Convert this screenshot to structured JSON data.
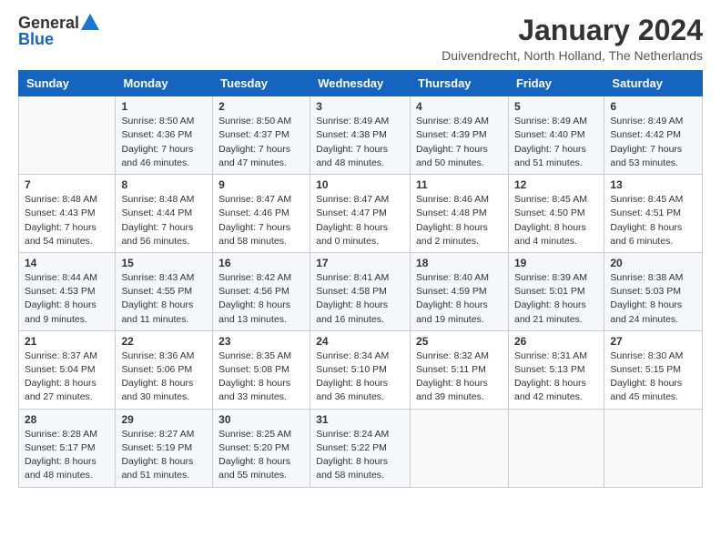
{
  "header": {
    "logo_general": "General",
    "logo_blue": "Blue",
    "month_title": "January 2024",
    "location": "Duivendrecht, North Holland, The Netherlands"
  },
  "days_of_week": [
    "Sunday",
    "Monday",
    "Tuesday",
    "Wednesday",
    "Thursday",
    "Friday",
    "Saturday"
  ],
  "weeks": [
    [
      {
        "day": "",
        "sunrise": "",
        "sunset": "",
        "daylight": ""
      },
      {
        "day": "1",
        "sunrise": "Sunrise: 8:50 AM",
        "sunset": "Sunset: 4:36 PM",
        "daylight": "Daylight: 7 hours and 46 minutes."
      },
      {
        "day": "2",
        "sunrise": "Sunrise: 8:50 AM",
        "sunset": "Sunset: 4:37 PM",
        "daylight": "Daylight: 7 hours and 47 minutes."
      },
      {
        "day": "3",
        "sunrise": "Sunrise: 8:49 AM",
        "sunset": "Sunset: 4:38 PM",
        "daylight": "Daylight: 7 hours and 48 minutes."
      },
      {
        "day": "4",
        "sunrise": "Sunrise: 8:49 AM",
        "sunset": "Sunset: 4:39 PM",
        "daylight": "Daylight: 7 hours and 50 minutes."
      },
      {
        "day": "5",
        "sunrise": "Sunrise: 8:49 AM",
        "sunset": "Sunset: 4:40 PM",
        "daylight": "Daylight: 7 hours and 51 minutes."
      },
      {
        "day": "6",
        "sunrise": "Sunrise: 8:49 AM",
        "sunset": "Sunset: 4:42 PM",
        "daylight": "Daylight: 7 hours and 53 minutes."
      }
    ],
    [
      {
        "day": "7",
        "sunrise": "Sunrise: 8:48 AM",
        "sunset": "Sunset: 4:43 PM",
        "daylight": "Daylight: 7 hours and 54 minutes."
      },
      {
        "day": "8",
        "sunrise": "Sunrise: 8:48 AM",
        "sunset": "Sunset: 4:44 PM",
        "daylight": "Daylight: 7 hours and 56 minutes."
      },
      {
        "day": "9",
        "sunrise": "Sunrise: 8:47 AM",
        "sunset": "Sunset: 4:46 PM",
        "daylight": "Daylight: 7 hours and 58 minutes."
      },
      {
        "day": "10",
        "sunrise": "Sunrise: 8:47 AM",
        "sunset": "Sunset: 4:47 PM",
        "daylight": "Daylight: 8 hours and 0 minutes."
      },
      {
        "day": "11",
        "sunrise": "Sunrise: 8:46 AM",
        "sunset": "Sunset: 4:48 PM",
        "daylight": "Daylight: 8 hours and 2 minutes."
      },
      {
        "day": "12",
        "sunrise": "Sunrise: 8:45 AM",
        "sunset": "Sunset: 4:50 PM",
        "daylight": "Daylight: 8 hours and 4 minutes."
      },
      {
        "day": "13",
        "sunrise": "Sunrise: 8:45 AM",
        "sunset": "Sunset: 4:51 PM",
        "daylight": "Daylight: 8 hours and 6 minutes."
      }
    ],
    [
      {
        "day": "14",
        "sunrise": "Sunrise: 8:44 AM",
        "sunset": "Sunset: 4:53 PM",
        "daylight": "Daylight: 8 hours and 9 minutes."
      },
      {
        "day": "15",
        "sunrise": "Sunrise: 8:43 AM",
        "sunset": "Sunset: 4:55 PM",
        "daylight": "Daylight: 8 hours and 11 minutes."
      },
      {
        "day": "16",
        "sunrise": "Sunrise: 8:42 AM",
        "sunset": "Sunset: 4:56 PM",
        "daylight": "Daylight: 8 hours and 13 minutes."
      },
      {
        "day": "17",
        "sunrise": "Sunrise: 8:41 AM",
        "sunset": "Sunset: 4:58 PM",
        "daylight": "Daylight: 8 hours and 16 minutes."
      },
      {
        "day": "18",
        "sunrise": "Sunrise: 8:40 AM",
        "sunset": "Sunset: 4:59 PM",
        "daylight": "Daylight: 8 hours and 19 minutes."
      },
      {
        "day": "19",
        "sunrise": "Sunrise: 8:39 AM",
        "sunset": "Sunset: 5:01 PM",
        "daylight": "Daylight: 8 hours and 21 minutes."
      },
      {
        "day": "20",
        "sunrise": "Sunrise: 8:38 AM",
        "sunset": "Sunset: 5:03 PM",
        "daylight": "Daylight: 8 hours and 24 minutes."
      }
    ],
    [
      {
        "day": "21",
        "sunrise": "Sunrise: 8:37 AM",
        "sunset": "Sunset: 5:04 PM",
        "daylight": "Daylight: 8 hours and 27 minutes."
      },
      {
        "day": "22",
        "sunrise": "Sunrise: 8:36 AM",
        "sunset": "Sunset: 5:06 PM",
        "daylight": "Daylight: 8 hours and 30 minutes."
      },
      {
        "day": "23",
        "sunrise": "Sunrise: 8:35 AM",
        "sunset": "Sunset: 5:08 PM",
        "daylight": "Daylight: 8 hours and 33 minutes."
      },
      {
        "day": "24",
        "sunrise": "Sunrise: 8:34 AM",
        "sunset": "Sunset: 5:10 PM",
        "daylight": "Daylight: 8 hours and 36 minutes."
      },
      {
        "day": "25",
        "sunrise": "Sunrise: 8:32 AM",
        "sunset": "Sunset: 5:11 PM",
        "daylight": "Daylight: 8 hours and 39 minutes."
      },
      {
        "day": "26",
        "sunrise": "Sunrise: 8:31 AM",
        "sunset": "Sunset: 5:13 PM",
        "daylight": "Daylight: 8 hours and 42 minutes."
      },
      {
        "day": "27",
        "sunrise": "Sunrise: 8:30 AM",
        "sunset": "Sunset: 5:15 PM",
        "daylight": "Daylight: 8 hours and 45 minutes."
      }
    ],
    [
      {
        "day": "28",
        "sunrise": "Sunrise: 8:28 AM",
        "sunset": "Sunset: 5:17 PM",
        "daylight": "Daylight: 8 hours and 48 minutes."
      },
      {
        "day": "29",
        "sunrise": "Sunrise: 8:27 AM",
        "sunset": "Sunset: 5:19 PM",
        "daylight": "Daylight: 8 hours and 51 minutes."
      },
      {
        "day": "30",
        "sunrise": "Sunrise: 8:25 AM",
        "sunset": "Sunset: 5:20 PM",
        "daylight": "Daylight: 8 hours and 55 minutes."
      },
      {
        "day": "31",
        "sunrise": "Sunrise: 8:24 AM",
        "sunset": "Sunset: 5:22 PM",
        "daylight": "Daylight: 8 hours and 58 minutes."
      },
      {
        "day": "",
        "sunrise": "",
        "sunset": "",
        "daylight": ""
      },
      {
        "day": "",
        "sunrise": "",
        "sunset": "",
        "daylight": ""
      },
      {
        "day": "",
        "sunrise": "",
        "sunset": "",
        "daylight": ""
      }
    ]
  ]
}
